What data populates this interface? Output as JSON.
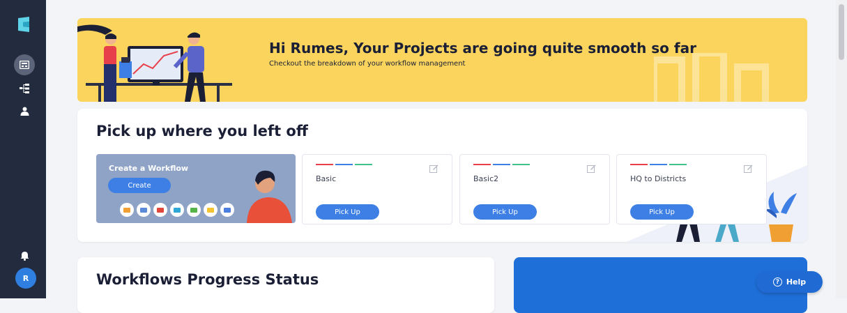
{
  "sidebar": {
    "avatar_initial": "R",
    "items": [
      "logo-icon",
      "dashboard-icon",
      "workflow-tree-icon",
      "user-icon",
      "bell-icon"
    ]
  },
  "banner": {
    "title": "Hi Rumes, Your Projects are going quite smooth so far",
    "subtitle": "Checkout the breakdown of your workflow management"
  },
  "pickup": {
    "title": "Pick up where you left off",
    "create": {
      "label": "Create a Workflow",
      "button": "Create",
      "app_icon_colors": [
        "#f0a033",
        "#5b8ad8",
        "#e0463a",
        "#2fa8d8",
        "#55b548",
        "#f4c430",
        "#4a7fe0"
      ]
    },
    "workflows": [
      {
        "name": "Basic",
        "button": "Pick Up"
      },
      {
        "name": "Basic2",
        "button": "Pick Up"
      },
      {
        "name": "HQ to Districts",
        "button": "Pick Up"
      }
    ],
    "bar_colors": [
      "#e8404a",
      "#3d7fe5",
      "#3fc38a"
    ]
  },
  "progress": {
    "title": "Workflows Progress Status"
  },
  "help": {
    "label": "Help"
  },
  "colors": {
    "sidebar": "#232b3e",
    "banner": "#fad45c",
    "accent": "#3d7fe5"
  }
}
